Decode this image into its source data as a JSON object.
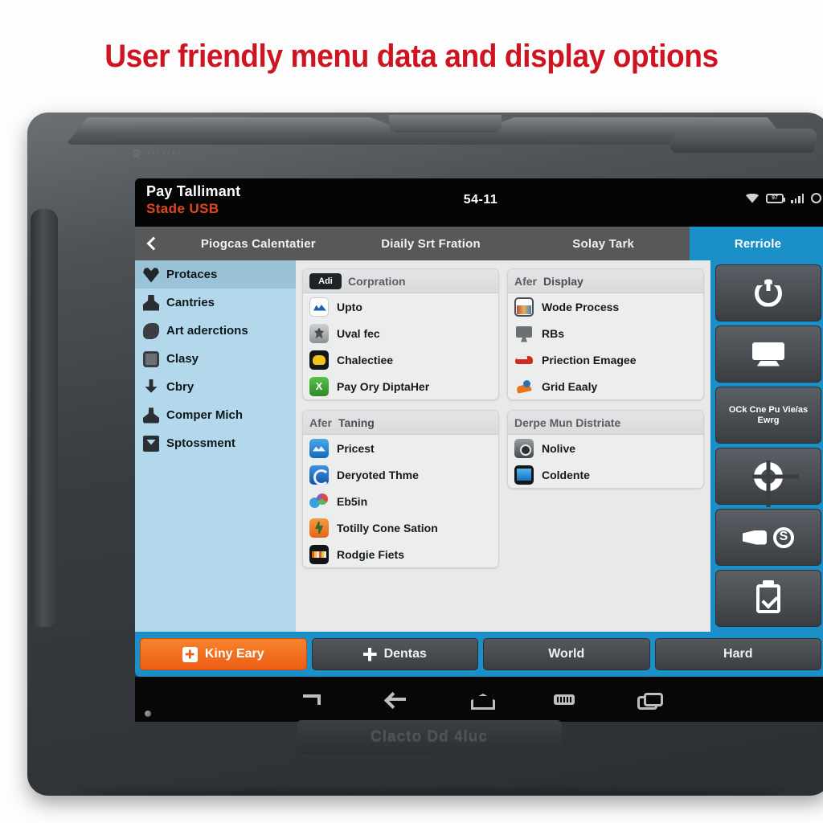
{
  "headline": "User friendly menu data and display options",
  "device": {
    "logo_emboss": "⊙ ·······",
    "brand_bottom": "Clacto Dd 4luc"
  },
  "screen": {
    "statusbar": {
      "title": "Pay Tallimant",
      "subtitle": "Stade USB",
      "clock": "54-11",
      "battery_text": "97",
      "icons": [
        "wifi-icon",
        "battery-icon",
        "signal-icon",
        "circle-icon"
      ]
    },
    "tabs": [
      {
        "label": "Piogcas Calentatier",
        "active": false
      },
      {
        "label": "Diaily Srt Fration",
        "active": false
      },
      {
        "label": "Solay Tark",
        "active": false
      },
      {
        "label": "Rerriole",
        "active": true
      }
    ],
    "sidebar": [
      {
        "label": "Protaces",
        "icon": "heart-icon",
        "selected": true
      },
      {
        "label": "Cantries",
        "icon": "user-icon",
        "selected": false
      },
      {
        "label": "Art aderctions",
        "icon": "leaf-icon",
        "selected": false
      },
      {
        "label": "Clasy",
        "icon": "frame-icon",
        "selected": false
      },
      {
        "label": "Cbry",
        "icon": "download-icon",
        "selected": false
      },
      {
        "label": "Comper Mich",
        "icon": "person-icon",
        "selected": false
      },
      {
        "label": "Sptossment",
        "icon": "inbox-icon",
        "selected": false
      }
    ],
    "panels": [
      {
        "badge": "Adi",
        "header": "Corpration",
        "header2": "",
        "items": [
          {
            "label": "Upto",
            "icon": "chart-white-icon"
          },
          {
            "label": "Uval fec",
            "icon": "snowflake-grey-icon"
          },
          {
            "label": "Chalectiee",
            "icon": "cloud-dark-icon"
          },
          {
            "label": "Pay Ory DiptaHer",
            "icon": "x-green-icon"
          }
        ]
      },
      {
        "badge": "",
        "header": "Afer",
        "header2": "Taning",
        "items": [
          {
            "label": "Pricest",
            "icon": "chart-blue-icon"
          },
          {
            "label": "Deryoted Thme",
            "icon": "refresh-blue-icon"
          },
          {
            "label": "Eb5in",
            "icon": "bubbles-multi-icon"
          },
          {
            "label": "Totilly Cone Sation",
            "icon": "tree-orange-icon"
          },
          {
            "label": "Rodgie Fiets",
            "icon": "film-black-icon"
          }
        ]
      },
      {
        "badge": "",
        "header": "Afer",
        "header2": "Display",
        "items": [
          {
            "label": "Wode Process",
            "icon": "photo-icon"
          },
          {
            "label": "RBs",
            "icon": "monitor-icon"
          },
          {
            "label": "Priection Emagee",
            "icon": "car-icon"
          },
          {
            "label": "Grid Eaaly",
            "icon": "worker-icon"
          }
        ]
      },
      {
        "badge": "",
        "header": "Derpe Mun Distriate",
        "header2": "",
        "items": [
          {
            "label": "Nolive",
            "icon": "camera-icon"
          },
          {
            "label": "Coldente",
            "icon": "bluescreen-icon"
          }
        ]
      }
    ],
    "action_column": {
      "title": "Rerriole",
      "buttons": [
        {
          "glyph": "power-icon",
          "label": ""
        },
        {
          "glyph": "screen-icon",
          "label": ""
        },
        {
          "glyph": "",
          "label": "OCk Cne Pu Vie/as Ewrg"
        },
        {
          "glyph": "donut-icon",
          "label": ""
        },
        {
          "glyph": "torch-s-icon",
          "label": ""
        },
        {
          "glyph": "clipboard-check-icon",
          "label": ""
        }
      ]
    },
    "bottom_buttons": [
      {
        "label": "Kiny Eary",
        "icon": "plus-box-icon",
        "primary": true
      },
      {
        "label": "Dentas",
        "icon": "plus-icon",
        "primary": false
      },
      {
        "label": "World",
        "icon": "",
        "primary": false
      },
      {
        "label": "Hard",
        "icon": "",
        "primary": false
      }
    ]
  },
  "navbar": [
    "return-icon",
    "back-icon",
    "home-icon",
    "keyboard-icon",
    "recents-icon"
  ],
  "colors": {
    "headline_red": "#cf1421",
    "accent_blue": "#1b90c8",
    "accent_orange": "#ec5e14",
    "sidebar_blue": "#b3d8ec",
    "status_orange": "#e0471f"
  }
}
